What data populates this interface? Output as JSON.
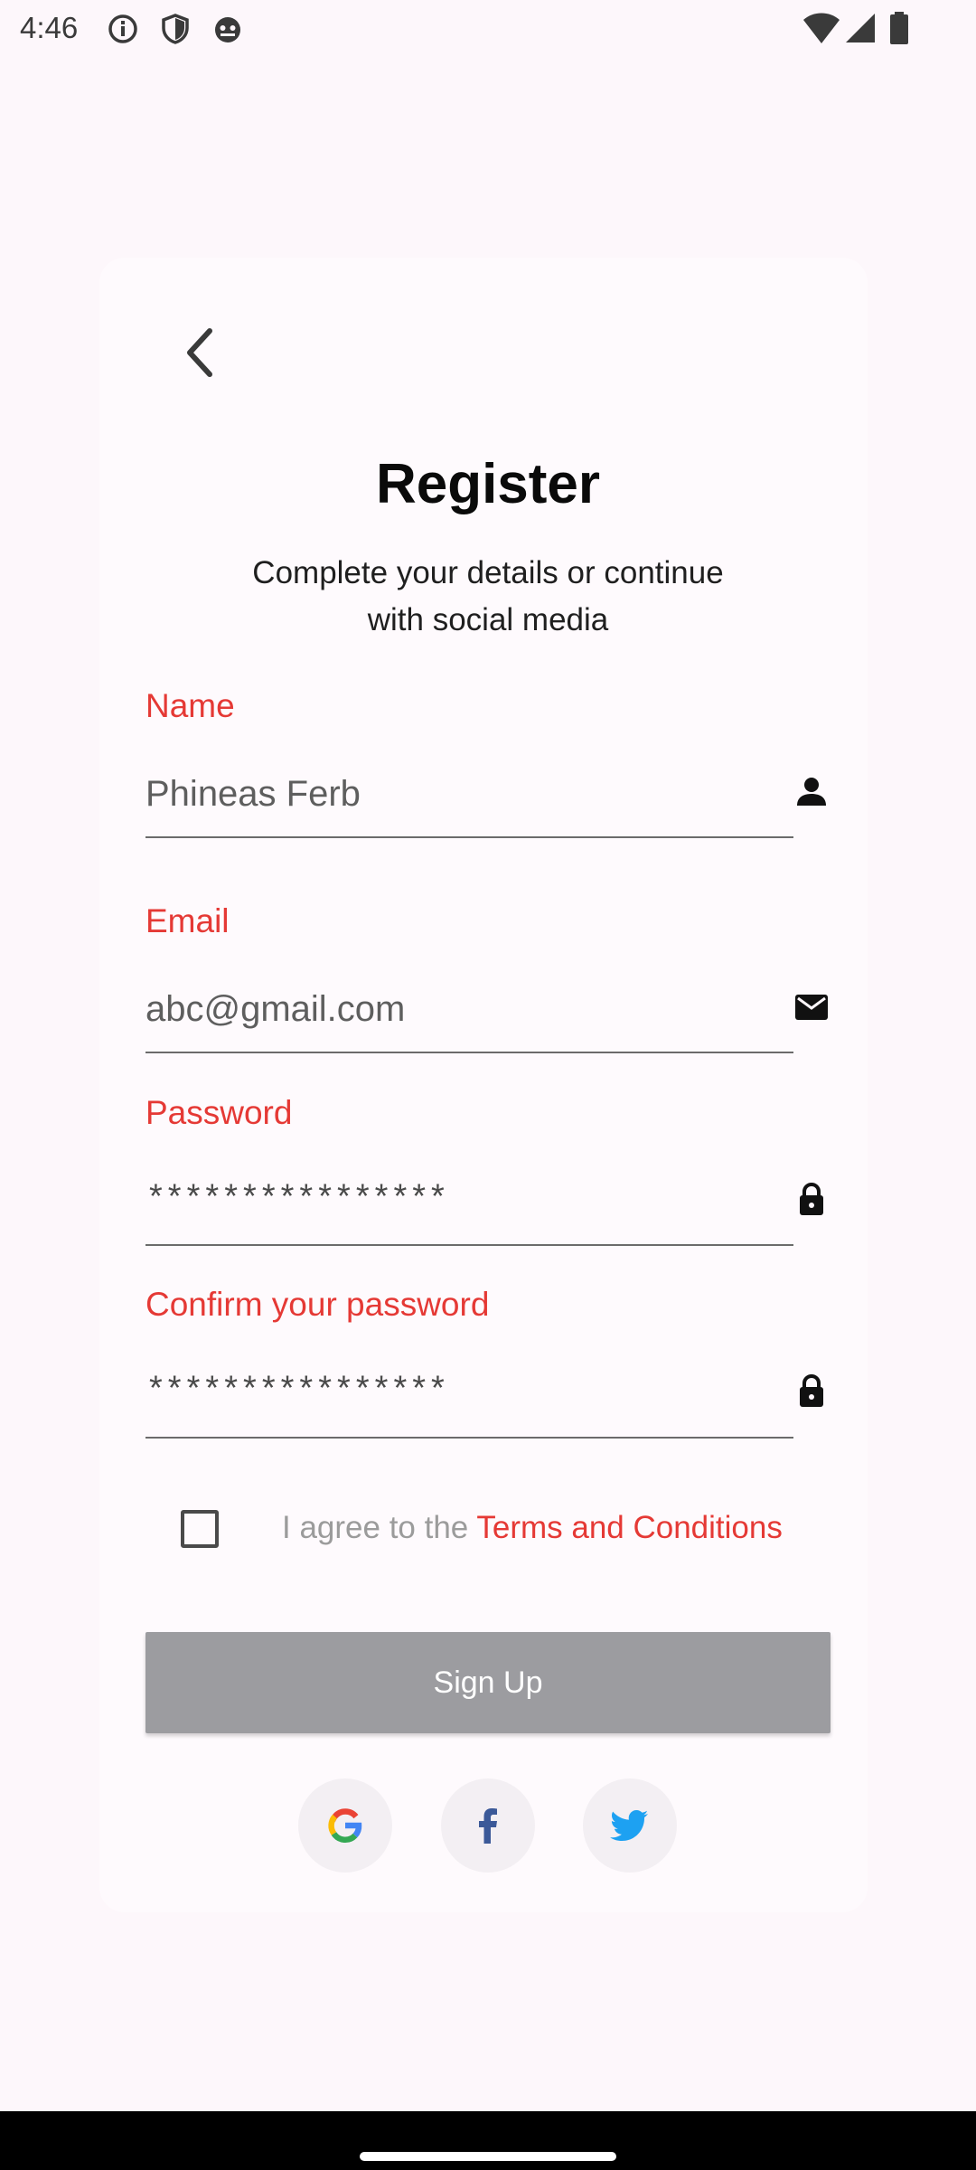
{
  "status_bar": {
    "time": "4:46"
  },
  "header": {
    "title": "Register",
    "subtitle_line1": "Complete your details or continue",
    "subtitle_line2": "with social media"
  },
  "form": {
    "name": {
      "label": "Name",
      "value": "Phineas Ferb"
    },
    "email": {
      "label": "Email",
      "value": "abc@gmail.com"
    },
    "password": {
      "label": "Password",
      "value": "****************"
    },
    "confirm_password": {
      "label": "Confirm your password",
      "value": "****************"
    },
    "agree_prefix": "I agree to the",
    "terms_link": "Terms and Conditions",
    "terms_checked": false
  },
  "signup_button": {
    "label": "Sign Up",
    "enabled": false
  },
  "social": [
    "google-icon",
    "facebook-icon",
    "twitter-icon"
  ],
  "colors": {
    "accent_red": "#e53935",
    "button_disabled": "#9c9ca0",
    "background": "#fdf7fb",
    "facebook": "#3b5998",
    "twitter": "#1da1f2"
  }
}
